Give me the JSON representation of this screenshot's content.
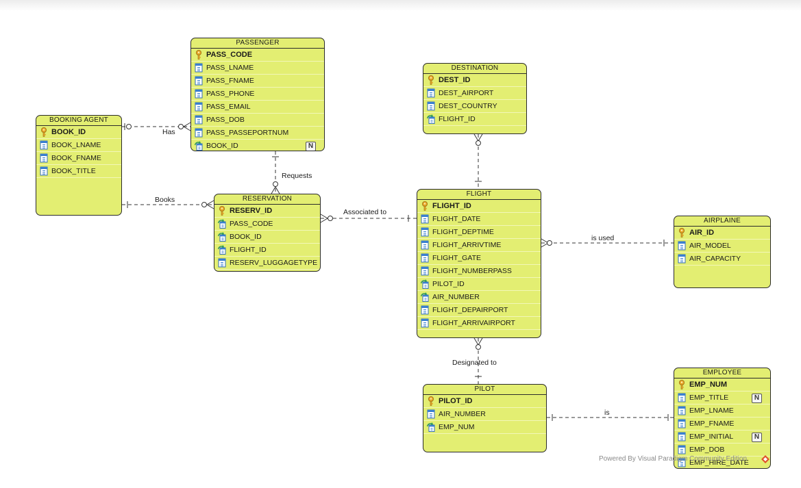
{
  "entities": {
    "passenger": {
      "name": "PASSENGER",
      "attrs": [
        {
          "name": "PASS_CODE",
          "kind": "pk"
        },
        {
          "name": "PASS_LNAME",
          "kind": "col"
        },
        {
          "name": "PASS_FNAME",
          "kind": "col"
        },
        {
          "name": "PASS_PHONE",
          "kind": "col"
        },
        {
          "name": "PASS_EMAIL",
          "kind": "col"
        },
        {
          "name": "PASS_DOB",
          "kind": "col"
        },
        {
          "name": "PASS_PASSEPORTNUM",
          "kind": "col"
        },
        {
          "name": "BOOK_ID",
          "kind": "fk",
          "nullable": "N"
        }
      ]
    },
    "booking_agent": {
      "name": "BOOKING AGENT",
      "attrs": [
        {
          "name": "BOOK_ID",
          "kind": "pk"
        },
        {
          "name": "BOOK_LNAME",
          "kind": "col"
        },
        {
          "name": "BOOK_FNAME",
          "kind": "col"
        },
        {
          "name": "BOOK_TITLE",
          "kind": "col"
        }
      ]
    },
    "reservation": {
      "name": "RESERVATION",
      "attrs": [
        {
          "name": "RESERV_ID",
          "kind": "pk"
        },
        {
          "name": "PASS_CODE",
          "kind": "fk"
        },
        {
          "name": "BOOK_ID",
          "kind": "fk"
        },
        {
          "name": "FLIGHT_ID",
          "kind": "fk"
        },
        {
          "name": "RESERV_LUGGAGETYPE",
          "kind": "col"
        }
      ]
    },
    "destination": {
      "name": "DESTINATION",
      "attrs": [
        {
          "name": "DEST_ID",
          "kind": "pk"
        },
        {
          "name": "DEST_AIRPORT",
          "kind": "col"
        },
        {
          "name": "DEST_COUNTRY",
          "kind": "col"
        },
        {
          "name": "FLIGHT_ID",
          "kind": "fk"
        }
      ]
    },
    "flight": {
      "name": "FLIGHT",
      "attrs": [
        {
          "name": "FLIGHT_ID",
          "kind": "pk"
        },
        {
          "name": "FLIGHT_DATE",
          "kind": "col"
        },
        {
          "name": "FLIGHT_DEPTIME",
          "kind": "col"
        },
        {
          "name": "FLIGHT_ARRIVTIME",
          "kind": "col"
        },
        {
          "name": "FLIGHT_GATE",
          "kind": "col"
        },
        {
          "name": "FLIGHT_NUMBERPASS",
          "kind": "col"
        },
        {
          "name": "PILOT_ID",
          "kind": "fk"
        },
        {
          "name": "AIR_NUMBER",
          "kind": "fk"
        },
        {
          "name": "FLIGHT_DEPAIRPORT",
          "kind": "col"
        },
        {
          "name": "FLIGHT_ARRIVAIRPORT",
          "kind": "col"
        }
      ]
    },
    "airplaine": {
      "name": "AIRPLAINE",
      "attrs": [
        {
          "name": "AIR_ID",
          "kind": "pk"
        },
        {
          "name": "AIR_MODEL",
          "kind": "col"
        },
        {
          "name": "AIR_CAPACITY",
          "kind": "col"
        }
      ]
    },
    "pilot": {
      "name": "PILOT",
      "attrs": [
        {
          "name": "PILOT_ID",
          "kind": "pk"
        },
        {
          "name": "AIR_NUMBER",
          "kind": "col"
        },
        {
          "name": "EMP_NUM",
          "kind": "fk"
        }
      ]
    },
    "employee": {
      "name": "EMPLOYEE",
      "attrs": [
        {
          "name": "EMP_NUM",
          "kind": "pk"
        },
        {
          "name": "EMP_TITLE",
          "kind": "col",
          "nullable": "N"
        },
        {
          "name": "EMP_LNAME",
          "kind": "col"
        },
        {
          "name": "EMP_FNAME",
          "kind": "col"
        },
        {
          "name": "EMP_INITIAL",
          "kind": "col",
          "nullable": "N"
        },
        {
          "name": "EMP_DOB",
          "kind": "col"
        },
        {
          "name": "EMP_HIRE_DATE",
          "kind": "col"
        }
      ]
    }
  },
  "relationships": {
    "has": "Has",
    "books": "Books",
    "requests": "Requests",
    "associated_to": "Associated to",
    "is_used": "is used",
    "designated_to": "Designated to",
    "is": "is"
  },
  "footer": "Powered By Visual Paradigm Community Edition",
  "colors": {
    "entity_fill": "#e3ee72",
    "border": "#2a2a2a",
    "key": "#e8a92a",
    "column_icon": "#3a7fd0",
    "fk_arrow": "#2f9a5a"
  }
}
